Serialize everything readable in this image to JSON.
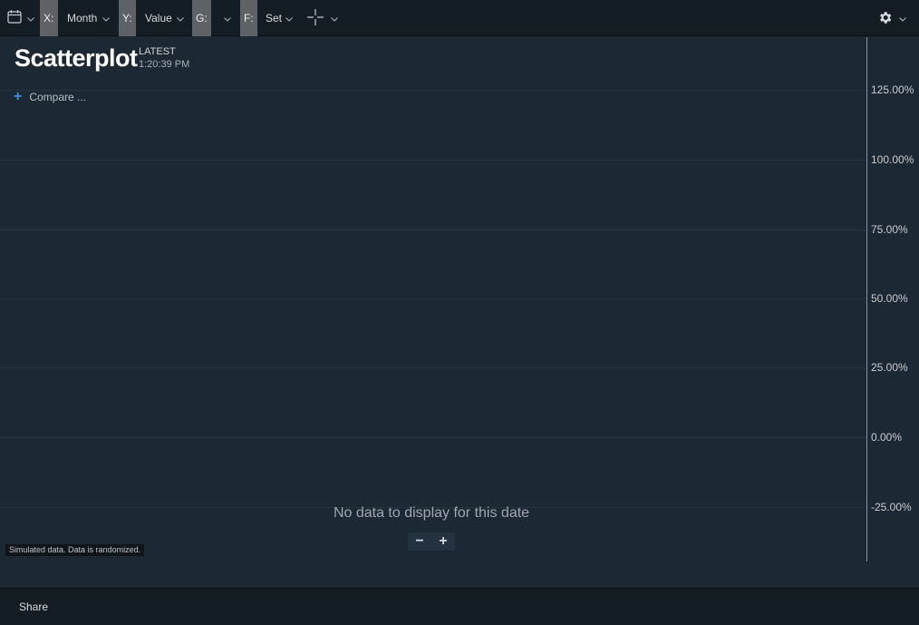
{
  "toolbar": {
    "x_prefix": "X:",
    "x_value": "Month",
    "y_prefix": "Y:",
    "y_value": "Value",
    "g_prefix": "G:",
    "g_value": "",
    "f_prefix": "F:",
    "f_value": "Set",
    "icons": [
      "calendar-icon",
      "crosshair-icon",
      "gear-icon",
      "chevron-down-icon"
    ]
  },
  "chart": {
    "title": "Scatterplot",
    "latest_label": "LATEST",
    "latest_time": "1:20:39 PM",
    "compare_label": "Compare ...",
    "no_data": "No data to display for this date",
    "zoom_out": "−",
    "zoom_in": "+",
    "simulated_note": "Simulated data.  Data is randomized."
  },
  "chart_data": {
    "type": "scatter",
    "title": "Scatterplot",
    "xlabel": "Month",
    "ylabel": "Value",
    "y_tick_labels": [
      "125.00%",
      "100.00%",
      "75.00%",
      "50.00%",
      "25.00%",
      "0.00%",
      "-25.00%"
    ],
    "y_ticks": [
      125,
      100,
      75,
      50,
      25,
      0,
      -25
    ],
    "series": [],
    "grid": true
  },
  "footer": {
    "share_label": "Share"
  },
  "colors": {
    "background": "#1c2834",
    "toolbar": "#141c24",
    "chip": "#5e6166",
    "accent": "#3a8fe0"
  }
}
